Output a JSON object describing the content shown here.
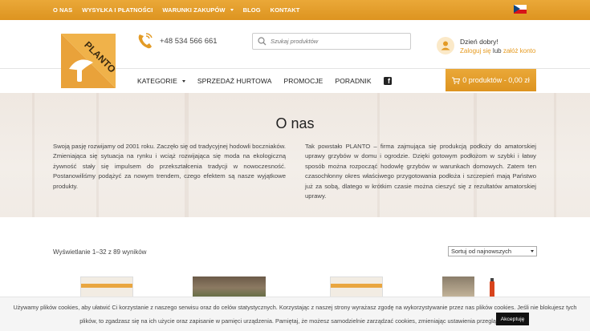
{
  "topbar": {
    "items": [
      {
        "label": "O NAS"
      },
      {
        "label": "WYSYŁKA I PŁATNOŚCI"
      },
      {
        "label": "WARUNKI ZAKUPÓW"
      },
      {
        "label": "BLOG"
      },
      {
        "label": "KONTAKT"
      }
    ],
    "language_flag": "czech-flag-icon"
  },
  "header": {
    "logo_text": "PLANTO",
    "phone": "+48 534 566 661",
    "search_placeholder": "Szukaj produktów",
    "greeting": "Dzień dobry!",
    "login_link": "Zaloguj się",
    "or_text": "lub",
    "register_link": "załóż konto"
  },
  "nav": {
    "items": [
      {
        "label": "KATEGORIE"
      },
      {
        "label": "SPRZEDAŻ HURTOWA"
      },
      {
        "label": "PROMOCJE"
      },
      {
        "label": "PORADNIK"
      }
    ],
    "cart_label": "0 produktów - 0,00 zł"
  },
  "hero": {
    "title": "O nas",
    "paragraph_left": "Swoją pasję rozwijamy od 2001 roku. Zaczęło się od tradycyjnej hodowli boczniaków. Zmieniająca się sytuacja na rynku i wciąż rozwijająca się moda na ekologiczną żywność stały się impulsem do przekształcenia tradycji w nowoczesność. Postanowiliśmy podążyć za nowym trendem, czego efektem są nasze wyjątkowe produkty.",
    "paragraph_right": "Tak powstało PLANTO – firma zajmująca się produkcją podłoży do amatorskiej uprawy grzybów w domu i ogrodzie. Dzięki gotowym podłożom w szybki i łatwy sposób można rozpocząć hodowlę grzybów w warunkach domowych. Zatem ten czasochłonny okres właściwego przygotowania podłoża i szczepień mają Państwo już za sobą, dlatego w krótkim czasie można cieszyć się z rezultatów amatorskiej uprawy."
  },
  "shop": {
    "results_text": "Wyświetlanie 1–32 z 89 wyników",
    "sort_selected": "Sortuj od najnowszych"
  },
  "cookie": {
    "text": "Używamy plików cookies, aby ułatwić Ci korzystanie z naszego serwisu oraz do celów statystycznych. Korzystając z naszej strony wyrażasz zgodę na wykorzystywanie przez nas plików cookies. Jeśli nie blokujesz tych plików, to zgadzasz się na ich użycie oraz zapisanie w pamięci urządzenia. Pamiętaj, że możesz samodzielnie zarządzać cookies, zmieniając ustawienia przeglądarki.",
    "accept_label": "Akceptuję"
  },
  "colors": {
    "accent": "#e39b26",
    "link": "#e69a1f"
  }
}
